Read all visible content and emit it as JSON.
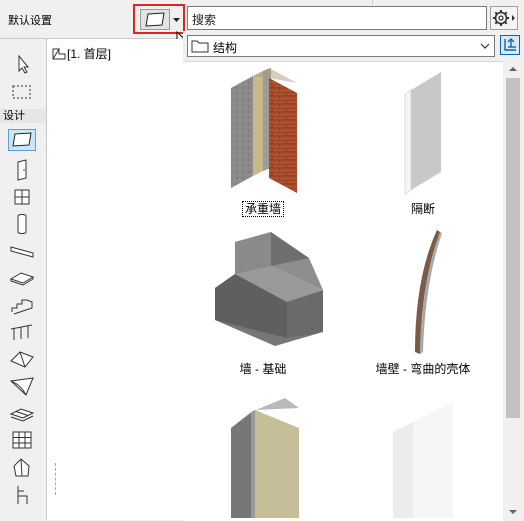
{
  "toolbar": {
    "default_setting_label": "默认设置",
    "search_placeholder": "搜索"
  },
  "toolbox": {
    "section_label": "设计",
    "tools": [
      {
        "name": "arrow-tool-icon"
      },
      {
        "name": "marquee-tool-icon"
      },
      {
        "name": "wall-tool-icon",
        "selected": true
      },
      {
        "name": "door-tool-icon"
      },
      {
        "name": "window-tool-icon"
      },
      {
        "name": "column-tool-icon"
      },
      {
        "name": "beam-tool-icon"
      },
      {
        "name": "slab-tool-icon"
      },
      {
        "name": "stair-tool-icon"
      },
      {
        "name": "railing-tool-icon"
      },
      {
        "name": "roof-tool-icon"
      },
      {
        "name": "shell-tool-icon"
      },
      {
        "name": "mesh-tool-icon"
      },
      {
        "name": "curtain-wall-tool-icon"
      },
      {
        "name": "morph-tool-icon"
      },
      {
        "name": "object-tool-icon"
      }
    ]
  },
  "navigator": {
    "story_label": "[1. 首层]"
  },
  "library": {
    "folder_label": "结构",
    "items": [
      {
        "label": "承重墙",
        "focused": true
      },
      {
        "label": "隔断",
        "focused": false
      },
      {
        "label": "墙 - 基础",
        "focused": false
      },
      {
        "label": "墙壁 - 弯曲的壳体",
        "focused": false
      },
      {
        "label": "",
        "focused": false
      },
      {
        "label": "",
        "focused": false
      }
    ]
  },
  "colors": {
    "highlight_border": "#e0261c",
    "selection_fill": "#cde6f7",
    "accent_blue": "#0a64b4"
  }
}
